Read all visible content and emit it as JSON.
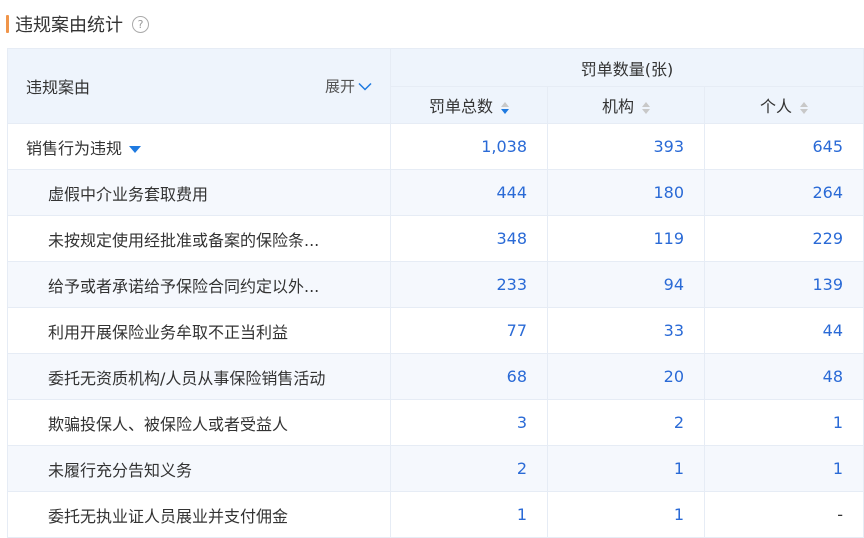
{
  "title": "违规案由统计",
  "help_icon": "?",
  "header": {
    "reason": "违规案由",
    "expand": "展开",
    "group": "罚单数量(张)",
    "cols": [
      "罚单总数",
      "机构",
      "个人"
    ]
  },
  "rows": [
    {
      "name": "销售行为违规",
      "total": "1,038",
      "org": "393",
      "person": "645",
      "group": true
    },
    {
      "name": "虚假中介业务套取费用",
      "total": "444",
      "org": "180",
      "person": "264"
    },
    {
      "name": "未按规定使用经批准或备案的保险条...",
      "total": "348",
      "org": "119",
      "person": "229"
    },
    {
      "name": "给予或者承诺给予保险合同约定以外...",
      "total": "233",
      "org": "94",
      "person": "139"
    },
    {
      "name": "利用开展保险业务牟取不正当利益",
      "total": "77",
      "org": "33",
      "person": "44"
    },
    {
      "name": "委托无资质机构/人员从事保险销售活动",
      "total": "68",
      "org": "20",
      "person": "48"
    },
    {
      "name": "欺骗投保人、被保险人或者受益人",
      "total": "3",
      "org": "2",
      "person": "1"
    },
    {
      "name": "未履行充分告知义务",
      "total": "2",
      "org": "1",
      "person": "1"
    },
    {
      "name": "委托无执业证人员展业并支付佣金",
      "total": "1",
      "org": "1",
      "person": "-"
    }
  ]
}
